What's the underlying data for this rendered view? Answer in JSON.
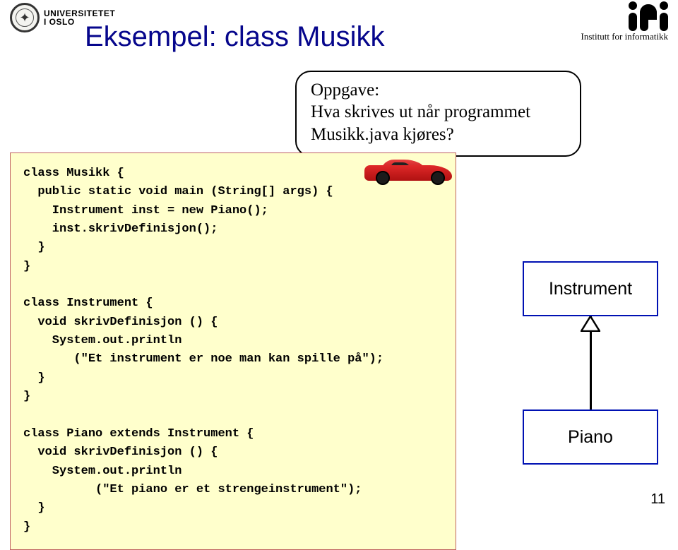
{
  "header": {
    "uio_line1": "UNIVERSITETET",
    "uio_line2": "I OSLO",
    "ifi_text": "Institutt for informatikk"
  },
  "slide": {
    "title": "Eksempel: class Musikk",
    "page_number": "11"
  },
  "task": {
    "label": "Oppgave:",
    "question_line1": "Hva skrives ut når programmet",
    "question_line2": "Musikk.java kjøres?"
  },
  "code": {
    "lines": [
      "class Musikk {",
      "  public static void main (String[] args) {",
      "    Instrument inst = new Piano();",
      "    inst.skrivDefinisjon();",
      "  }",
      "}",
      "",
      "class Instrument {",
      "  void skrivDefinisjon () {",
      "    System.out.println",
      "       (\"Et instrument er noe man kan spille på\");",
      "  }",
      "}",
      "",
      "class Piano extends Instrument {",
      "  void skrivDefinisjon () {",
      "    System.out.println",
      "          (\"Et piano er et strengeinstrument\");",
      "  }",
      "}"
    ]
  },
  "uml": {
    "parent": "Instrument",
    "child": "Piano"
  }
}
